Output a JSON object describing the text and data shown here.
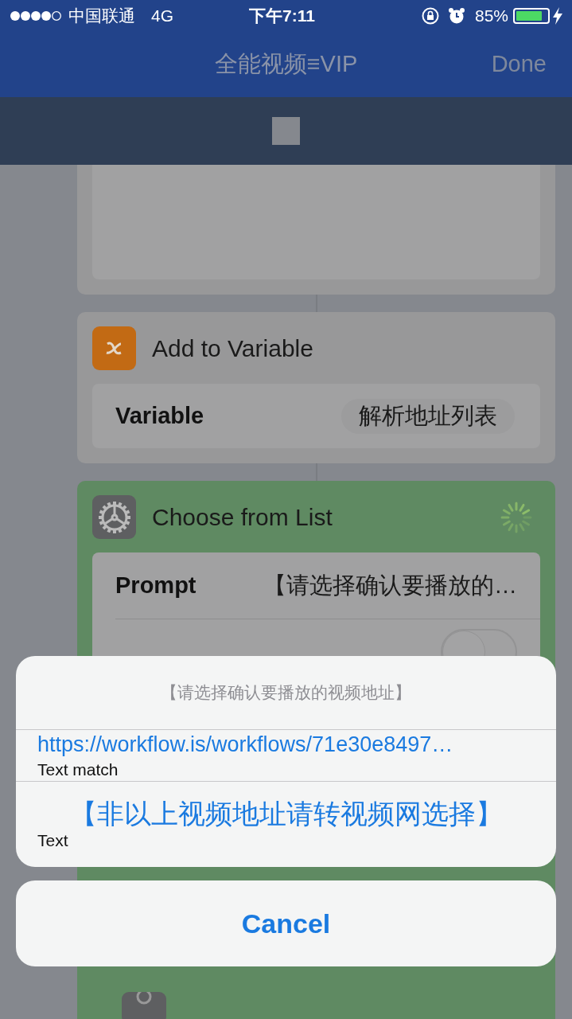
{
  "status_bar": {
    "carrier": "中国联通",
    "network": "4G",
    "time": "下午7:11",
    "battery": "85%"
  },
  "nav": {
    "title": "全能视频≡VIP",
    "done": "Done"
  },
  "actions": [
    {
      "kind": "text_block"
    },
    {
      "kind": "variable",
      "title": "Add to Variable",
      "param_label": "Variable",
      "param_value": "解析地址列表"
    },
    {
      "kind": "choose_list",
      "title": "Choose from List",
      "running": true,
      "params": [
        {
          "label": "Prompt",
          "value": "【请选择确认要播放的…"
        },
        {
          "on": false
        }
      ]
    }
  ],
  "sheet": {
    "title": "【请选择确认要播放的视频地址】",
    "options": [
      {
        "label": "https://workflow.is/workflows/71e30e8497…",
        "detail": "Text match",
        "kind": "link"
      },
      {
        "label": "【非以上视频地址请转视频网选择】",
        "detail": "Text",
        "kind": "choice"
      }
    ],
    "cancel": "Cancel"
  }
}
